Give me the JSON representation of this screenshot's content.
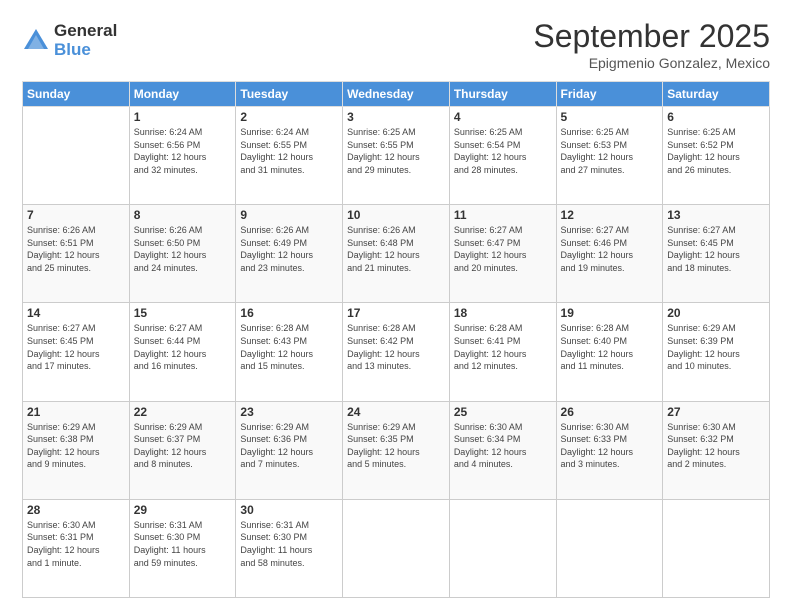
{
  "logo": {
    "general": "General",
    "blue": "Blue"
  },
  "header": {
    "month": "September 2025",
    "location": "Epigmenio Gonzalez, Mexico"
  },
  "weekdays": [
    "Sunday",
    "Monday",
    "Tuesday",
    "Wednesday",
    "Thursday",
    "Friday",
    "Saturday"
  ],
  "weeks": [
    [
      {
        "day": "",
        "info": ""
      },
      {
        "day": "1",
        "info": "Sunrise: 6:24 AM\nSunset: 6:56 PM\nDaylight: 12 hours\nand 32 minutes."
      },
      {
        "day": "2",
        "info": "Sunrise: 6:24 AM\nSunset: 6:55 PM\nDaylight: 12 hours\nand 31 minutes."
      },
      {
        "day": "3",
        "info": "Sunrise: 6:25 AM\nSunset: 6:55 PM\nDaylight: 12 hours\nand 29 minutes."
      },
      {
        "day": "4",
        "info": "Sunrise: 6:25 AM\nSunset: 6:54 PM\nDaylight: 12 hours\nand 28 minutes."
      },
      {
        "day": "5",
        "info": "Sunrise: 6:25 AM\nSunset: 6:53 PM\nDaylight: 12 hours\nand 27 minutes."
      },
      {
        "day": "6",
        "info": "Sunrise: 6:25 AM\nSunset: 6:52 PM\nDaylight: 12 hours\nand 26 minutes."
      }
    ],
    [
      {
        "day": "7",
        "info": "Sunrise: 6:26 AM\nSunset: 6:51 PM\nDaylight: 12 hours\nand 25 minutes."
      },
      {
        "day": "8",
        "info": "Sunrise: 6:26 AM\nSunset: 6:50 PM\nDaylight: 12 hours\nand 24 minutes."
      },
      {
        "day": "9",
        "info": "Sunrise: 6:26 AM\nSunset: 6:49 PM\nDaylight: 12 hours\nand 23 minutes."
      },
      {
        "day": "10",
        "info": "Sunrise: 6:26 AM\nSunset: 6:48 PM\nDaylight: 12 hours\nand 21 minutes."
      },
      {
        "day": "11",
        "info": "Sunrise: 6:27 AM\nSunset: 6:47 PM\nDaylight: 12 hours\nand 20 minutes."
      },
      {
        "day": "12",
        "info": "Sunrise: 6:27 AM\nSunset: 6:46 PM\nDaylight: 12 hours\nand 19 minutes."
      },
      {
        "day": "13",
        "info": "Sunrise: 6:27 AM\nSunset: 6:45 PM\nDaylight: 12 hours\nand 18 minutes."
      }
    ],
    [
      {
        "day": "14",
        "info": "Sunrise: 6:27 AM\nSunset: 6:45 PM\nDaylight: 12 hours\nand 17 minutes."
      },
      {
        "day": "15",
        "info": "Sunrise: 6:27 AM\nSunset: 6:44 PM\nDaylight: 12 hours\nand 16 minutes."
      },
      {
        "day": "16",
        "info": "Sunrise: 6:28 AM\nSunset: 6:43 PM\nDaylight: 12 hours\nand 15 minutes."
      },
      {
        "day": "17",
        "info": "Sunrise: 6:28 AM\nSunset: 6:42 PM\nDaylight: 12 hours\nand 13 minutes."
      },
      {
        "day": "18",
        "info": "Sunrise: 6:28 AM\nSunset: 6:41 PM\nDaylight: 12 hours\nand 12 minutes."
      },
      {
        "day": "19",
        "info": "Sunrise: 6:28 AM\nSunset: 6:40 PM\nDaylight: 12 hours\nand 11 minutes."
      },
      {
        "day": "20",
        "info": "Sunrise: 6:29 AM\nSunset: 6:39 PM\nDaylight: 12 hours\nand 10 minutes."
      }
    ],
    [
      {
        "day": "21",
        "info": "Sunrise: 6:29 AM\nSunset: 6:38 PM\nDaylight: 12 hours\nand 9 minutes."
      },
      {
        "day": "22",
        "info": "Sunrise: 6:29 AM\nSunset: 6:37 PM\nDaylight: 12 hours\nand 8 minutes."
      },
      {
        "day": "23",
        "info": "Sunrise: 6:29 AM\nSunset: 6:36 PM\nDaylight: 12 hours\nand 7 minutes."
      },
      {
        "day": "24",
        "info": "Sunrise: 6:29 AM\nSunset: 6:35 PM\nDaylight: 12 hours\nand 5 minutes."
      },
      {
        "day": "25",
        "info": "Sunrise: 6:30 AM\nSunset: 6:34 PM\nDaylight: 12 hours\nand 4 minutes."
      },
      {
        "day": "26",
        "info": "Sunrise: 6:30 AM\nSunset: 6:33 PM\nDaylight: 12 hours\nand 3 minutes."
      },
      {
        "day": "27",
        "info": "Sunrise: 6:30 AM\nSunset: 6:32 PM\nDaylight: 12 hours\nand 2 minutes."
      }
    ],
    [
      {
        "day": "28",
        "info": "Sunrise: 6:30 AM\nSunset: 6:31 PM\nDaylight: 12 hours\nand 1 minute."
      },
      {
        "day": "29",
        "info": "Sunrise: 6:31 AM\nSunset: 6:30 PM\nDaylight: 11 hours\nand 59 minutes."
      },
      {
        "day": "30",
        "info": "Sunrise: 6:31 AM\nSunset: 6:30 PM\nDaylight: 11 hours\nand 58 minutes."
      },
      {
        "day": "",
        "info": ""
      },
      {
        "day": "",
        "info": ""
      },
      {
        "day": "",
        "info": ""
      },
      {
        "day": "",
        "info": ""
      }
    ]
  ]
}
